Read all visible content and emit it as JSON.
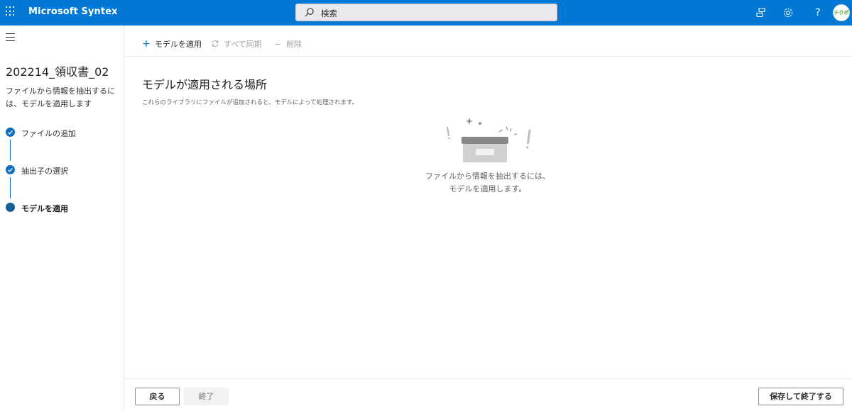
{
  "header": {
    "app_title": "Microsoft Syntex",
    "search_placeholder": "検索",
    "help_label": "?",
    "avatar_text": "テクポ"
  },
  "sidebar": {
    "model_title": "202214_領収書_02",
    "description": "ファイルから情報を抽出するには、モデルを適用します",
    "steps": [
      {
        "label": "ファイルの追加",
        "state": "completed"
      },
      {
        "label": "抽出子の選択",
        "state": "completed"
      },
      {
        "label": "モデルを適用",
        "state": "current"
      }
    ]
  },
  "commands": {
    "apply_model": "モデルを適用",
    "sync_all": "すべて同期",
    "delete": "削除"
  },
  "main": {
    "title": "モデルが適用される場所",
    "subtitle": "これらのライブラリにファイルが追加されると、モデルによって処理されます。",
    "empty_line1": "ファイルから情報を抽出するには、",
    "empty_line2": "モデルを適用します。"
  },
  "footer": {
    "back_label": "戻る",
    "finish_label": "終了",
    "save_exit_label": "保存して終了する"
  },
  "colors": {
    "brand": "#0078d4",
    "step_accent": "#106ebe"
  }
}
